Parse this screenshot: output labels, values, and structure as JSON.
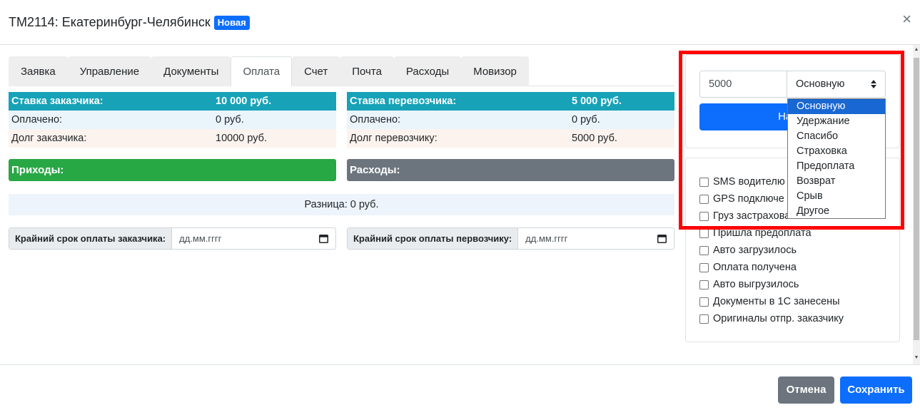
{
  "modal": {
    "title": "ТМ2114: Екатеринбург-Челябинск",
    "badge": "Новая",
    "close": "×"
  },
  "tabs": [
    {
      "label": "Заявка"
    },
    {
      "label": "Управление"
    },
    {
      "label": "Документы"
    },
    {
      "label": "Оплата",
      "active": true
    },
    {
      "label": "Счет"
    },
    {
      "label": "Почта"
    },
    {
      "label": "Расходы"
    },
    {
      "label": "Мовизор"
    }
  ],
  "customer": {
    "rate_label": "Ставка заказчика:",
    "rate_value": "10 000 руб.",
    "paid_label": "Оплачено:",
    "paid_value": "0 руб.",
    "debt_label": "Долг заказчика:",
    "debt_value": "10000 руб."
  },
  "carrier": {
    "rate_label": "Ставка перевозчика:",
    "rate_value": "5 000 руб.",
    "paid_label": "Оплачено:",
    "paid_value": "0 руб.",
    "debt_label": "Долг перевозчику:",
    "debt_value": "5000 руб."
  },
  "income_label": "Приходы:",
  "expense_label": "Расходы:",
  "difference": "Разница: 0 руб.",
  "deadlines": {
    "customer_label": "Крайний срок оплаты заказчика:",
    "customer_placeholder": "дд.мм.гггг",
    "carrier_label": "Крайний срок оплаты первозчику:",
    "carrier_placeholder": "дд.мм.гггг"
  },
  "payment": {
    "amount": "5000",
    "type_selected": "Основную",
    "button_partial": "На с",
    "options": [
      "Основную",
      "Удержание",
      "Спасибо",
      "Страховка",
      "Предоплата",
      "Возврат",
      "Срыв",
      "Другое"
    ]
  },
  "checks": [
    "SMS водителю",
    "GPS подключе",
    "Груз застрахован",
    "Пришла предоплата",
    "Авто загрузилось",
    "Оплата получена",
    "Авто выгрузилось",
    "Документы в 1С занесены",
    "Оригиналы отпр. заказчику"
  ],
  "footer": {
    "cancel": "Отмена",
    "save": "Сохранить"
  },
  "colors": {
    "rate_header": "#17a2b8",
    "income": "#28a745",
    "expense": "#6c757d",
    "primary": "#0d6efd",
    "highlight_frame": "#ff0000"
  }
}
